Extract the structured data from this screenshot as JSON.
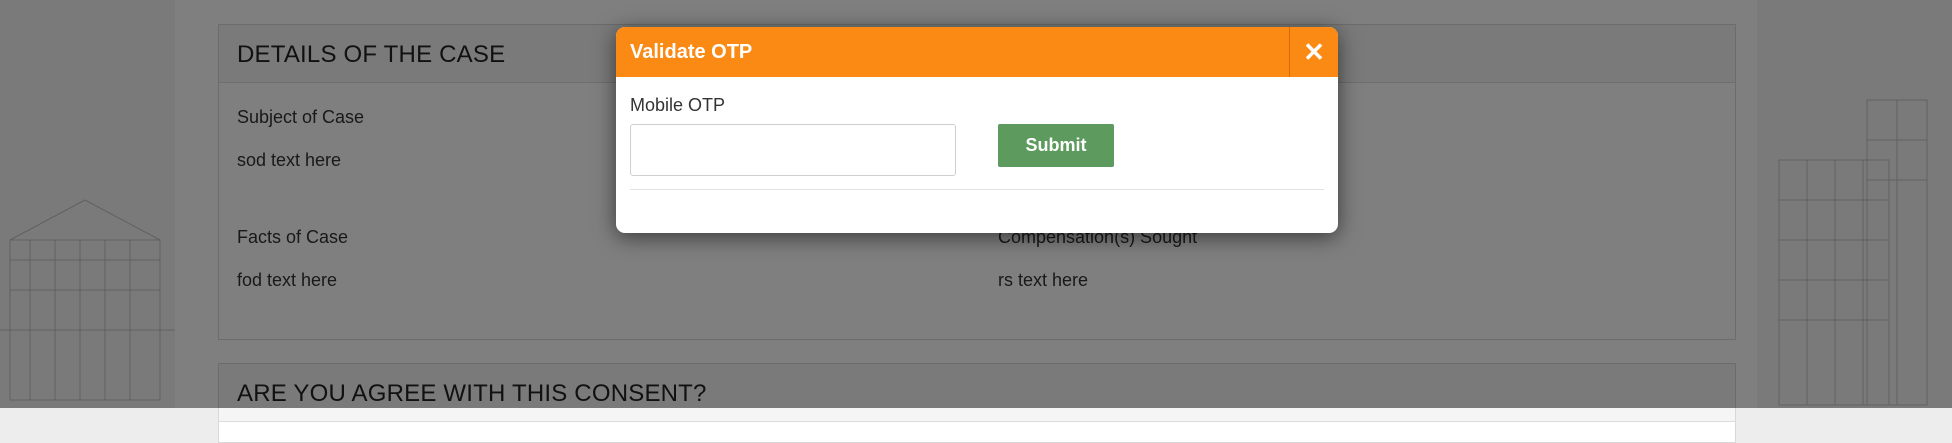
{
  "details": {
    "heading": "DETAILS OF THE CASE",
    "subject_label": "Subject of Case",
    "subject_value": "sod text here",
    "facts_label": "Facts of Case",
    "facts_value": "fod text here",
    "compensation_label": "Compensation(s) Sought",
    "compensation_value": "rs text here"
  },
  "consent": {
    "heading": "ARE YOU AGREE WITH THIS CONSENT?"
  },
  "modal": {
    "title": "Validate OTP",
    "close_icon": "close-icon",
    "otp_label": "Mobile OTP",
    "otp_value": "",
    "submit_label": "Submit"
  },
  "colors": {
    "header_orange": "#fb8a14",
    "submit_green": "#5d9a5d"
  }
}
